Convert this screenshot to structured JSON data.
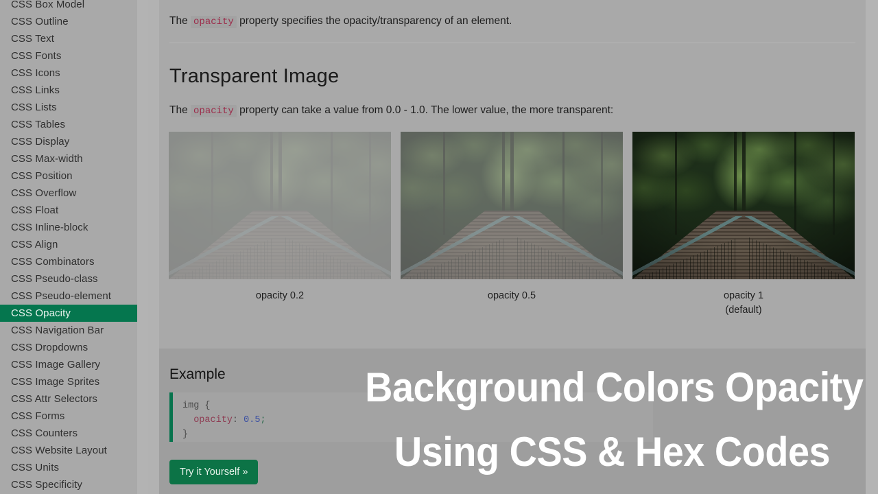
{
  "sidebar": {
    "items": [
      {
        "label": "CSS Box Model",
        "active": false
      },
      {
        "label": "CSS Outline",
        "active": false
      },
      {
        "label": "CSS Text",
        "active": false
      },
      {
        "label": "CSS Fonts",
        "active": false
      },
      {
        "label": "CSS Icons",
        "active": false
      },
      {
        "label": "CSS Links",
        "active": false
      },
      {
        "label": "CSS Lists",
        "active": false
      },
      {
        "label": "CSS Tables",
        "active": false
      },
      {
        "label": "CSS Display",
        "active": false
      },
      {
        "label": "CSS Max-width",
        "active": false
      },
      {
        "label": "CSS Position",
        "active": false
      },
      {
        "label": "CSS Overflow",
        "active": false
      },
      {
        "label": "CSS Float",
        "active": false
      },
      {
        "label": "CSS Inline-block",
        "active": false
      },
      {
        "label": "CSS Align",
        "active": false
      },
      {
        "label": "CSS Combinators",
        "active": false
      },
      {
        "label": "CSS Pseudo-class",
        "active": false
      },
      {
        "label": "CSS Pseudo-element",
        "active": false
      },
      {
        "label": "CSS Opacity",
        "active": true
      },
      {
        "label": "CSS Navigation Bar",
        "active": false
      },
      {
        "label": "CSS Dropdowns",
        "active": false
      },
      {
        "label": "CSS Image Gallery",
        "active": false
      },
      {
        "label": "CSS Image Sprites",
        "active": false
      },
      {
        "label": "CSS Attr Selectors",
        "active": false
      },
      {
        "label": "CSS Forms",
        "active": false
      },
      {
        "label": "CSS Counters",
        "active": false
      },
      {
        "label": "CSS Website Layout",
        "active": false
      },
      {
        "label": "CSS Units",
        "active": false
      },
      {
        "label": "CSS Specificity",
        "active": false
      }
    ],
    "active_color": "#05764e"
  },
  "main": {
    "intro_before": "The ",
    "intro_code": "opacity",
    "intro_after": " property specifies the opacity/transparency of an element.",
    "heading": "Transparent Image",
    "sub_before": "The ",
    "sub_code": "opacity",
    "sub_after": " property can take a value from 0.0 - 1.0. The lower value, the more transparent:",
    "images": [
      {
        "caption": "opacity 0.2",
        "caption2": "",
        "opacity": "0.2"
      },
      {
        "caption": "opacity 0.5",
        "caption2": "",
        "opacity": "0.5"
      },
      {
        "caption": "opacity 1",
        "caption2": "(default)",
        "opacity": "1"
      }
    ]
  },
  "example": {
    "title": "Example",
    "code_line1": "img {",
    "code_prop": "opacity",
    "code_colon": ": ",
    "code_value": "0.5",
    "code_semi": ";",
    "code_line3": "}",
    "button_label": "Try it Yourself »",
    "button_color": "#0c7346"
  },
  "overlay": {
    "line1": "Background Colors Opacity",
    "line2": "Using CSS & Hex Codes",
    "color": "#ffffff"
  }
}
